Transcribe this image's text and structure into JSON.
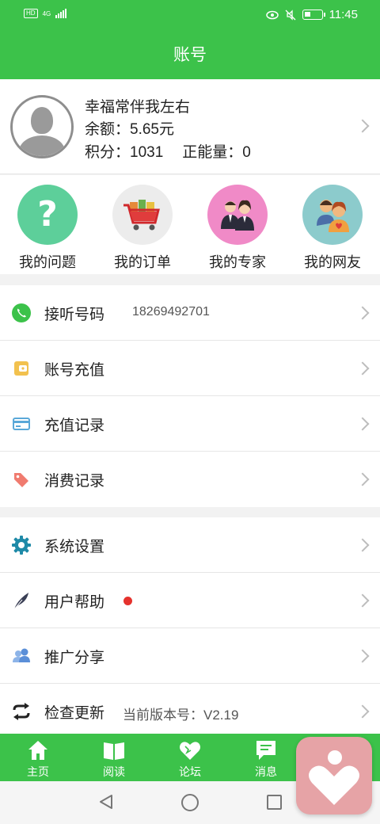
{
  "status_bar": {
    "hd": "HD",
    "network": "4G",
    "time": "11:45"
  },
  "header": {
    "title": "账号"
  },
  "profile": {
    "name": "幸福常伴我左右",
    "balance": "余额：5.65元",
    "points": "积分：1031",
    "energy": "正能量：0"
  },
  "quick_links": [
    {
      "label": "我的问题",
      "icon": "question-icon",
      "color": "#5dcf9a"
    },
    {
      "label": "我的订单",
      "icon": "cart-icon",
      "color": "#ececec"
    },
    {
      "label": "我的专家",
      "icon": "experts-icon",
      "color": "#f08ac7"
    },
    {
      "label": "我的网友",
      "icon": "friends-icon",
      "color": "#8ccbcc"
    }
  ],
  "menu_group1": [
    {
      "label": "接听号码",
      "value": "18269492701",
      "icon": "phone-icon"
    },
    {
      "label": "账号充值",
      "icon": "wallet-icon"
    },
    {
      "label": "充值记录",
      "icon": "card-icon"
    },
    {
      "label": "消费记录",
      "icon": "tag-icon"
    }
  ],
  "menu_group2": [
    {
      "label": "系统设置",
      "icon": "gear-icon"
    },
    {
      "label": "用户帮助",
      "icon": "feather-icon"
    },
    {
      "label": "推广分享",
      "icon": "users-icon"
    },
    {
      "label": "检查更新",
      "value": "当前版本号：V2.19",
      "icon": "refresh-icon"
    }
  ],
  "tabs": [
    {
      "label": "主页",
      "icon": "home-icon"
    },
    {
      "label": "阅读",
      "icon": "book-icon"
    },
    {
      "label": "论坛",
      "icon": "forum-heart-icon"
    },
    {
      "label": "消息",
      "icon": "message-icon"
    }
  ],
  "colors": {
    "primary": "#3cc24a",
    "dot": "#e5322d",
    "floating": "#e6a3a6"
  }
}
